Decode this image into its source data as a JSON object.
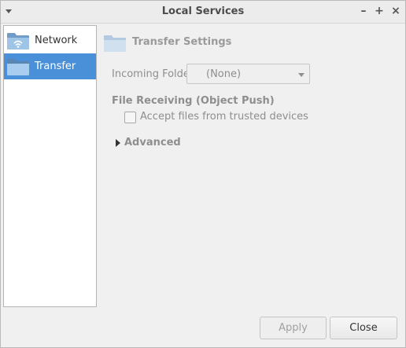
{
  "window": {
    "title": "Local Services",
    "controls": {
      "minimize": "–",
      "maximize": "+",
      "close": "×"
    }
  },
  "sidebar": {
    "items": [
      {
        "label": "Network",
        "icon": "network-folder-icon",
        "selected": false
      },
      {
        "label": "Transfer",
        "icon": "folder-icon",
        "selected": true
      }
    ]
  },
  "content": {
    "section_title": "Transfer Settings",
    "incoming_folder_label": "Incoming Folder:",
    "incoming_folder_value": "(None)",
    "file_receiving_label": "File Receiving (Object Push)",
    "accept_trusted_label": "Accept files from trusted devices",
    "accept_trusted_checked": false,
    "advanced_label": "Advanced"
  },
  "buttons": {
    "apply": "Apply",
    "close": "Close"
  },
  "colors": {
    "selection": "#4a90d9",
    "folder": "#9ec4e6",
    "folder_dark": "#6f9cc9"
  }
}
